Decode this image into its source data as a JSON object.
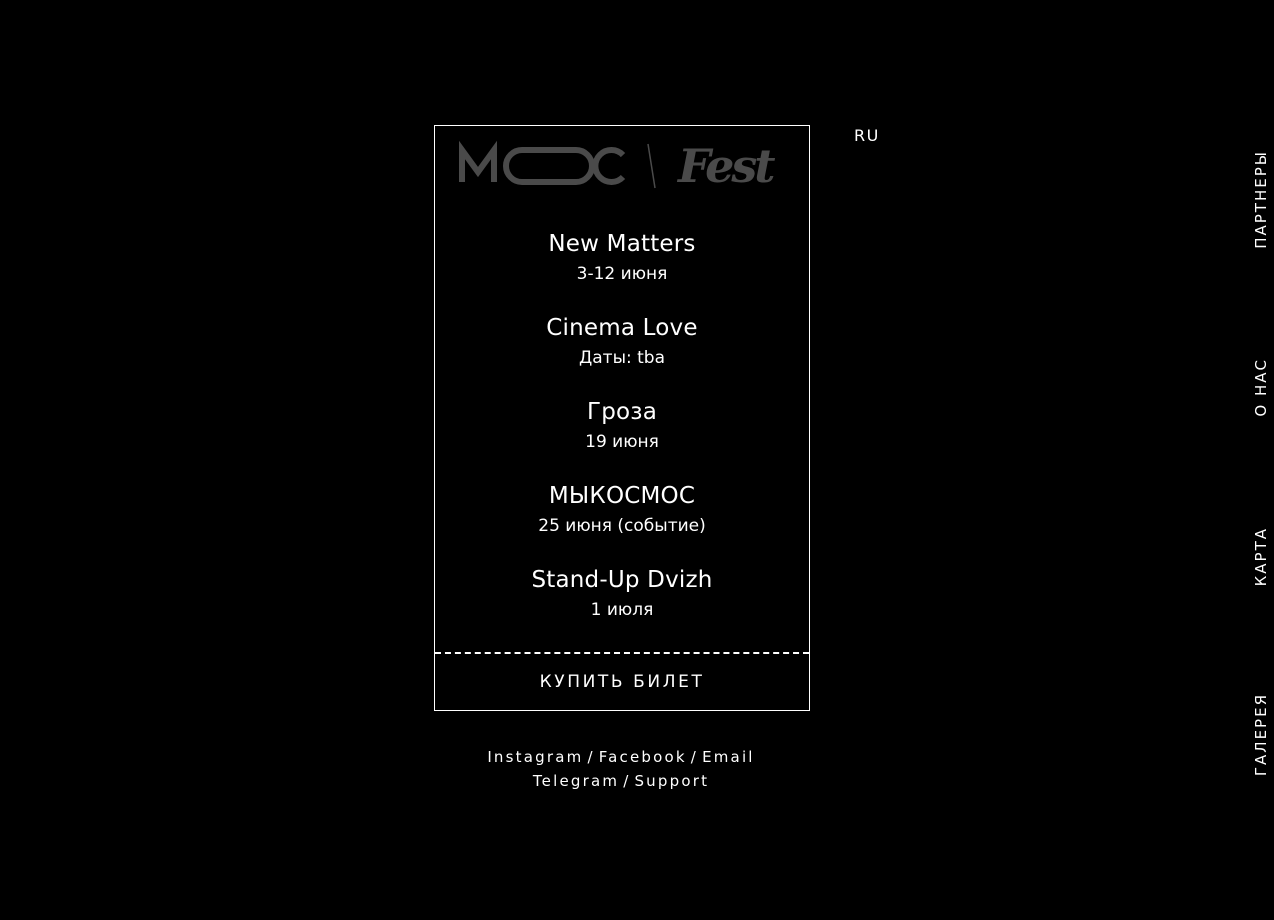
{
  "language": "RU",
  "logo": {
    "left_text": "MOOC",
    "right_text": "Fest"
  },
  "events": [
    {
      "name": "New Matters",
      "date": "3-12 июня"
    },
    {
      "name": "Cinema Love",
      "date": "Даты: tba"
    },
    {
      "name": "Гроза",
      "date": "19 июня"
    },
    {
      "name": "МЫКОСМОС",
      "date": "25 июня (событие)"
    },
    {
      "name": "Stand-Up Dvizh",
      "date": "1 июля"
    }
  ],
  "buy_button": "КУПИТЬ БИЛЕТ",
  "links": {
    "instagram": "Instagram",
    "facebook": "Facebook",
    "email": "Email",
    "telegram": "Telegram",
    "support": "Support",
    "separator": "/"
  },
  "side_nav": {
    "partners": "ПАРТНЕРЫ",
    "about": "О НАС",
    "map": "КАРТА",
    "gallery": "ГАЛЕРЕЯ"
  },
  "colors": {
    "background": "#000000",
    "text": "#ffffff",
    "logo": "#4a4a4a"
  }
}
